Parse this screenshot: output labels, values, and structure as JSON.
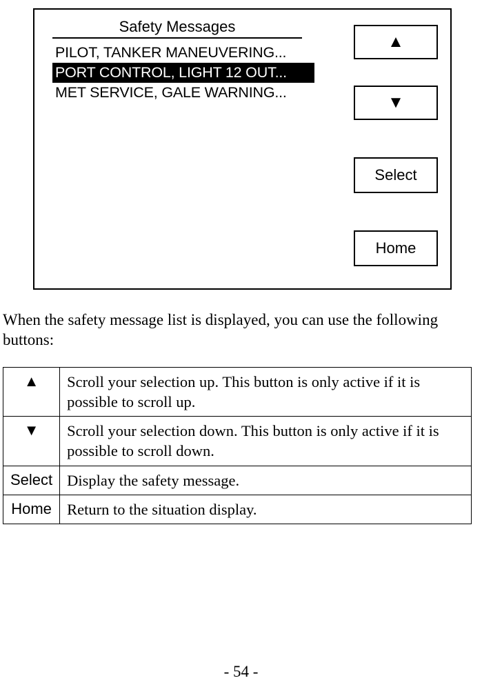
{
  "screen": {
    "title": "Safety Messages",
    "messages": [
      {
        "text": "PILOT, TANKER MANEUVERING...",
        "selected": false
      },
      {
        "text": "PORT CONTROL, LIGHT 12 OUT...",
        "selected": true
      },
      {
        "text": "MET SERVICE, GALE WARNING...",
        "selected": false
      }
    ],
    "buttons": {
      "up": "▲",
      "down": "▼",
      "select": "Select",
      "home": "Home"
    }
  },
  "body_paragraph": "When the safety message list is displayed, you can use the following buttons:",
  "table_rows": [
    {
      "icon": "▲",
      "desc": "Scroll your selection up. This button is only active if it is possible to scroll up."
    },
    {
      "icon": "▼",
      "desc": "Scroll your selection down. This button is only active if it is possible to scroll down."
    },
    {
      "icon": "Select",
      "desc": "Display the safety message."
    },
    {
      "icon": "Home",
      "desc": "Return to the situation display."
    }
  ],
  "page_number": "- 54 -"
}
